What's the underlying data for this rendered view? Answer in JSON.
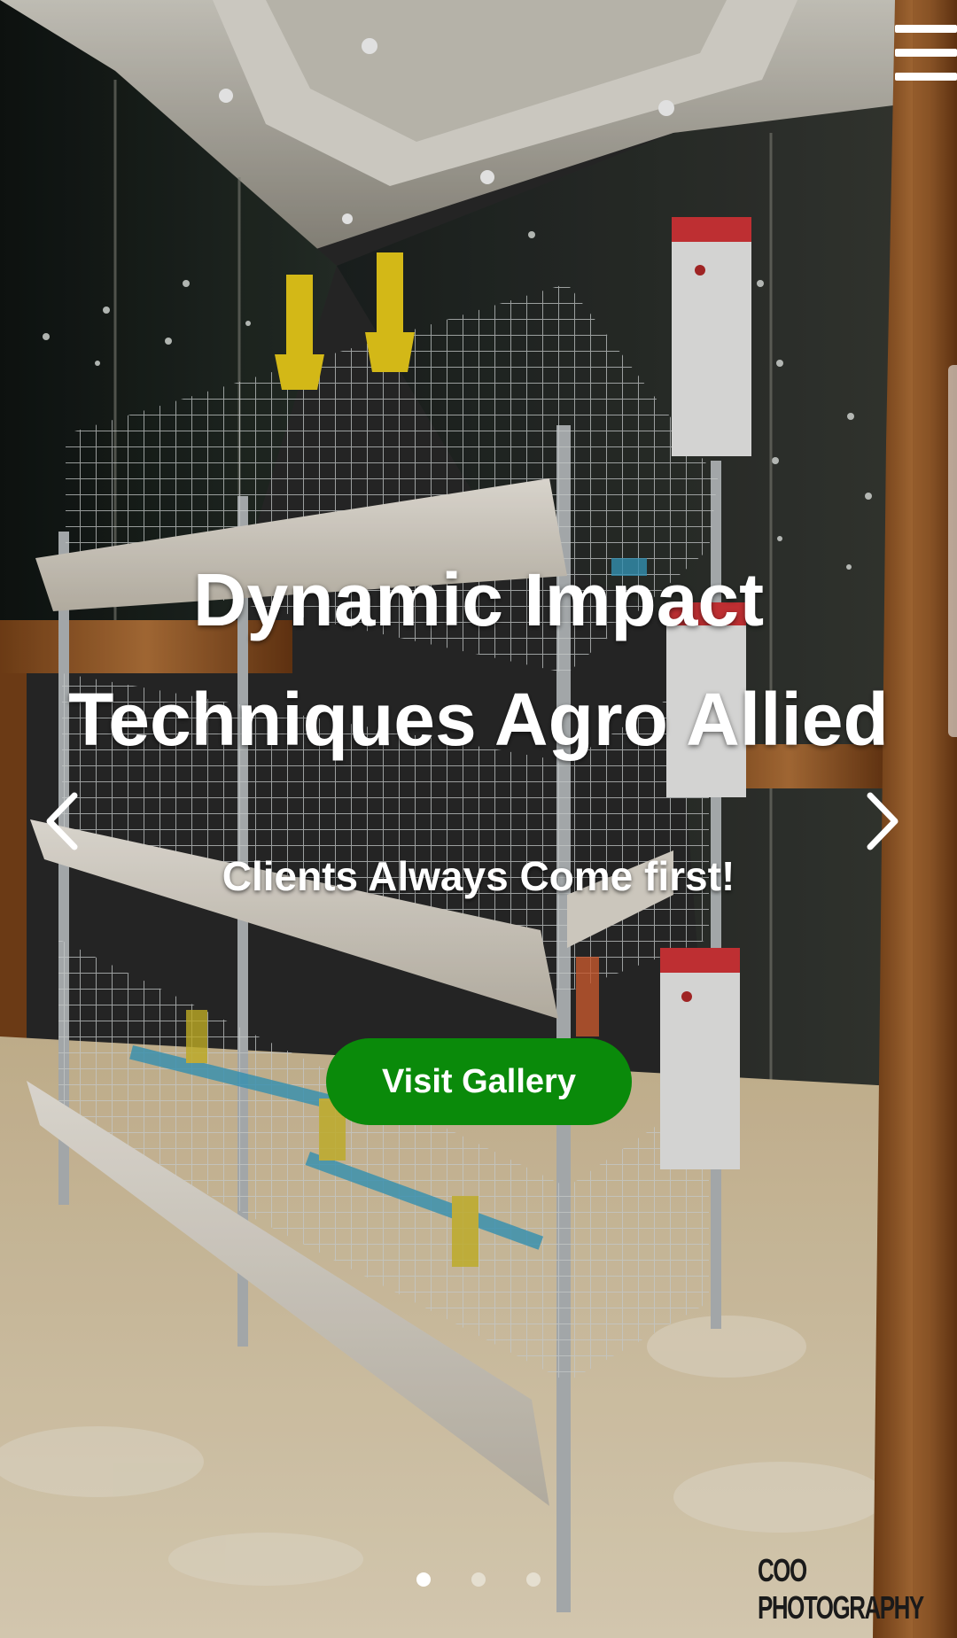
{
  "header": {
    "menu_icon": "hamburger-menu-icon"
  },
  "hero": {
    "title_line1": "Dynamic Impact",
    "title_line2": "Techniques Agro Allied",
    "subtitle": "Clients Always Come first!",
    "cta_label": "Visit Gallery",
    "cta_color": "#0a8a0a",
    "prev_icon": "chevron-left-icon",
    "next_icon": "chevron-right-icon",
    "slides_total": 3,
    "active_slide": 1
  },
  "image": {
    "description_icon": "poultry-cage-photo",
    "watermark": "COO PHOTOGRAPHY"
  }
}
